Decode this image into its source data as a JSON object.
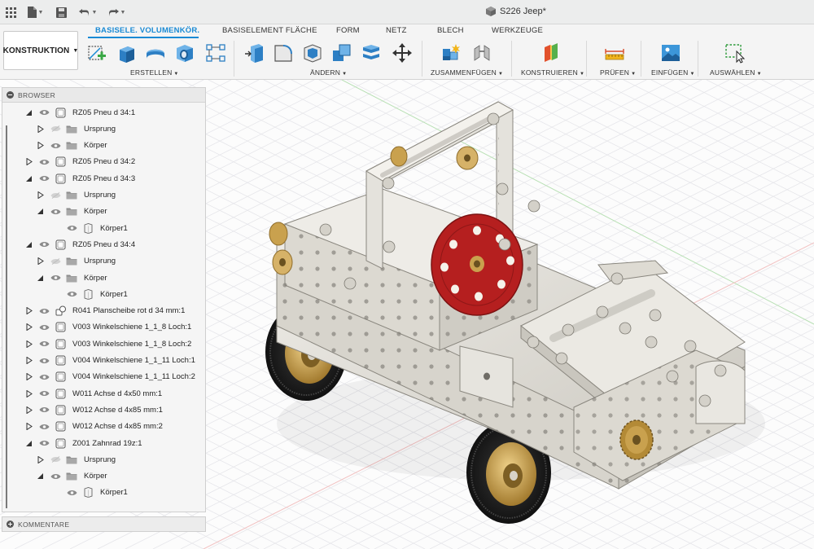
{
  "app": {
    "document_title": "S226 Jeep*"
  },
  "topbar": {
    "icons": [
      "grid-icon",
      "file-icon",
      "save-icon",
      "undo-icon",
      "redo-icon"
    ]
  },
  "ribbon": {
    "workspace_label": "KONSTRUKTION",
    "tabs": [
      {
        "label": "BASISELE. VOLUMENKÖR.",
        "active": true
      },
      {
        "label": "BASISELEMENT FLÄCHE",
        "active": false
      },
      {
        "label": "FORM",
        "active": false
      },
      {
        "label": "NETZ",
        "active": false
      },
      {
        "label": "BLECH",
        "active": false
      },
      {
        "label": "WERKZEUGE",
        "active": false
      }
    ],
    "groups": [
      {
        "label": "ERSTELLEN"
      },
      {
        "label": "ÄNDERN"
      },
      {
        "label": "ZUSAMMENFÜGEN"
      },
      {
        "label": "KONSTRUIEREN"
      },
      {
        "label": "PRÜFEN"
      },
      {
        "label": "EINFÜGEN"
      },
      {
        "label": "AUSWÄHLEN"
      }
    ],
    "accent_color": "#1a8ad4"
  },
  "browser": {
    "title": "BROWSER",
    "items": [
      {
        "label": "RZ05 Pneu d 34:1",
        "level": 0,
        "expanded": true,
        "type": "component",
        "visible": true
      },
      {
        "label": "Ursprung",
        "level": 1,
        "expanded": false,
        "type": "folder",
        "visible": false
      },
      {
        "label": "Körper",
        "level": 1,
        "expanded": false,
        "type": "folder",
        "visible": true
      },
      {
        "label": "RZ05 Pneu d 34:2",
        "level": 0,
        "expanded": false,
        "type": "component",
        "visible": true
      },
      {
        "label": "RZ05 Pneu d 34:3",
        "level": 0,
        "expanded": true,
        "type": "component",
        "visible": true
      },
      {
        "label": "Ursprung",
        "level": 1,
        "expanded": false,
        "type": "folder",
        "visible": false
      },
      {
        "label": "Körper",
        "level": 1,
        "expanded": true,
        "type": "folder",
        "visible": true
      },
      {
        "label": "Körper1",
        "level": 2,
        "expanded": null,
        "type": "body",
        "visible": true
      },
      {
        "label": "RZ05 Pneu d 34:4",
        "level": 0,
        "expanded": true,
        "type": "component",
        "visible": true
      },
      {
        "label": "Ursprung",
        "level": 1,
        "expanded": false,
        "type": "folder",
        "visible": false
      },
      {
        "label": "Körper",
        "level": 1,
        "expanded": true,
        "type": "folder",
        "visible": true
      },
      {
        "label": "Körper1",
        "level": 2,
        "expanded": null,
        "type": "body",
        "visible": true
      },
      {
        "label": "R041 Planscheibe rot d 34 mm:1",
        "level": 0,
        "expanded": false,
        "type": "assembly",
        "visible": true
      },
      {
        "label": "V003 Winkelschiene 1_1_8 Loch:1",
        "level": 0,
        "expanded": false,
        "type": "component",
        "visible": true
      },
      {
        "label": "V003 Winkelschiene 1_1_8 Loch:2",
        "level": 0,
        "expanded": false,
        "type": "component",
        "visible": true
      },
      {
        "label": "V004 Winkelschiene 1_1_11 Loch:1",
        "level": 0,
        "expanded": false,
        "type": "component",
        "visible": true
      },
      {
        "label": "V004 Winkelschiene 1_1_11 Loch:2",
        "level": 0,
        "expanded": false,
        "type": "component",
        "visible": true
      },
      {
        "label": "W011 Achse d 4x50 mm:1",
        "level": 0,
        "expanded": false,
        "type": "component",
        "visible": true
      },
      {
        "label": "W012 Achse d 4x85 mm:1",
        "level": 0,
        "expanded": false,
        "type": "component",
        "visible": true
      },
      {
        "label": "W012 Achse d 4x85 mm:2",
        "level": 0,
        "expanded": false,
        "type": "component",
        "visible": true
      },
      {
        "label": "Z001 Zahnrad 19z:1",
        "level": 0,
        "expanded": true,
        "type": "component",
        "visible": true
      },
      {
        "label": "Ursprung",
        "level": 1,
        "expanded": false,
        "type": "folder",
        "visible": false
      },
      {
        "label": "Körper",
        "level": 1,
        "expanded": true,
        "type": "folder",
        "visible": true
      },
      {
        "label": "Körper1",
        "level": 2,
        "expanded": null,
        "type": "body",
        "visible": true
      }
    ]
  },
  "comments": {
    "title": "KOMMENTARE"
  },
  "model": {
    "colors": {
      "metal": "#e4e2dc",
      "metal_dark": "#b9b6ae",
      "disc_red": "#b51f1f",
      "brass": "#c9a14e",
      "tire": "#1d1d1d",
      "grid": "#e6e6ea"
    }
  }
}
